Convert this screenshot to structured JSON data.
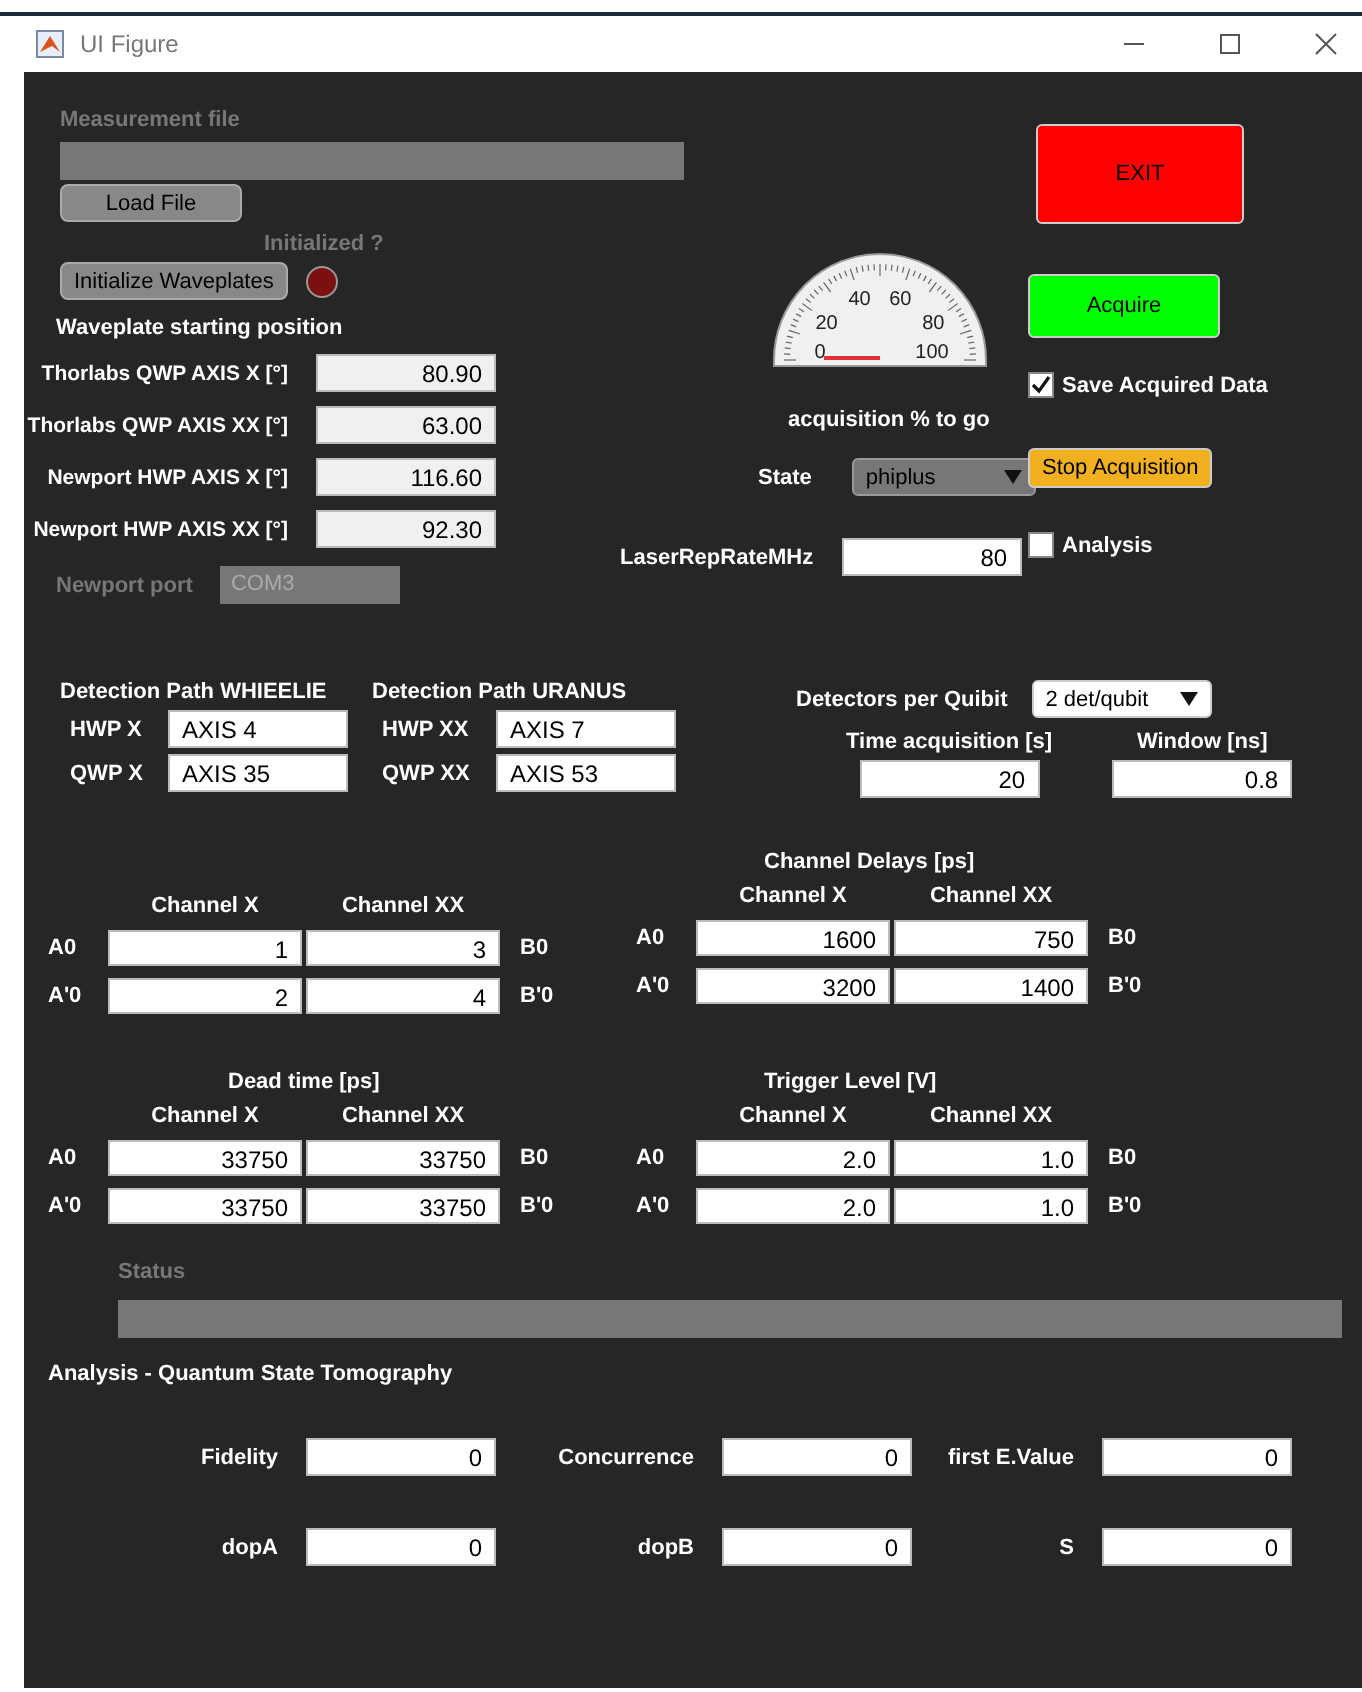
{
  "window": {
    "title": "UI Figure"
  },
  "file": {
    "label": "Measurement file",
    "button": "Load File",
    "disabled": true
  },
  "init": {
    "label": "Initialized ?",
    "button": "Initialize Waveplates",
    "lamp_on": false
  },
  "waveplates": {
    "title": "Waveplate starting position",
    "rows": [
      {
        "label": "Thorlabs QWP AXIS X [°]",
        "value": "80.90"
      },
      {
        "label": "Thorlabs QWP AXIS XX [°]",
        "value": "63.00"
      },
      {
        "label": "Newport HWP AXIS X [°]",
        "value": "116.60"
      },
      {
        "label": "Newport HWP AXIS XX [°]",
        "value": "92.30"
      }
    ]
  },
  "port": {
    "label": "Newport port",
    "value": "COM3",
    "disabled": true
  },
  "gauge": {
    "ticks": [
      "0",
      "20",
      "40",
      "60",
      "80",
      "100"
    ],
    "label": "acquisition % to go"
  },
  "state": {
    "label": "State",
    "value": "phiplus"
  },
  "laser": {
    "label": "LaserRepRateMHz",
    "value": "80"
  },
  "exit_button": "EXIT",
  "acquire_button": "Acquire",
  "stop_button": "Stop Acquisition",
  "checks": [
    {
      "label": "Save Acquired Data",
      "checked": true
    },
    {
      "label": "Analysis",
      "checked": false
    }
  ],
  "paths": [
    {
      "title": "Detection Path WHIEELIE",
      "rows": [
        {
          "label": "HWP X",
          "value": "AXIS 4"
        },
        {
          "label": "QWP X",
          "value": "AXIS 35"
        }
      ]
    },
    {
      "title": "Detection Path URANUS",
      "rows": [
        {
          "label": "HWP XX",
          "value": "AXIS 7"
        },
        {
          "label": "QWP XX",
          "value": "AXIS 53"
        }
      ]
    }
  ],
  "detectors": {
    "label": "Detectors per Quibit",
    "value": "2 det/qubit"
  },
  "timing": [
    {
      "label": "Time acquisition [s]",
      "value": "20"
    },
    {
      "label": "Window [ns]",
      "value": "0.8"
    }
  ],
  "grids": [
    {
      "columns": [
        "Channel X",
        "Channel XX"
      ],
      "rows": [
        {
          "left": "A0",
          "values": [
            "1",
            "3"
          ],
          "right": "B0"
        },
        {
          "left": "A'0",
          "values": [
            "2",
            "4"
          ],
          "right": "B'0"
        }
      ]
    },
    {
      "title": "Dead time [ps]",
      "columns": [
        "Channel X",
        "Channel XX"
      ],
      "rows": [
        {
          "left": "A0",
          "values": [
            "33750",
            "33750"
          ],
          "right": "B0"
        },
        {
          "left": "A'0",
          "values": [
            "33750",
            "33750"
          ],
          "right": "B'0"
        }
      ]
    },
    {
      "title": "Channel Delays [ps]",
      "columns": [
        "Channel X",
        "Channel XX"
      ],
      "rows": [
        {
          "left": "A0",
          "values": [
            "1600",
            "750"
          ],
          "right": "B0"
        },
        {
          "left": "A'0",
          "values": [
            "3200",
            "1400"
          ],
          "right": "B'0"
        }
      ]
    },
    {
      "title": "Trigger Level [V]",
      "columns": [
        "Channel X",
        "Channel XX"
      ],
      "rows": [
        {
          "left": "A0",
          "values": [
            "2.0",
            "1.0"
          ],
          "right": "B0"
        },
        {
          "left": "A'0",
          "values": [
            "2.0",
            "1.0"
          ],
          "right": "B'0"
        }
      ]
    }
  ],
  "status": {
    "label": "Status",
    "disabled": true
  },
  "analysis": {
    "title": "Analysis - Quantum State Tomography",
    "fields": [
      {
        "label": "Fidelity",
        "value": "0"
      },
      {
        "label": "Concurrence",
        "value": "0"
      },
      {
        "label": "first E.Value",
        "value": "0"
      },
      {
        "label": "dopA",
        "value": "0"
      },
      {
        "label": "dopB",
        "value": "0"
      },
      {
        "label": "S",
        "value": "0"
      }
    ]
  }
}
